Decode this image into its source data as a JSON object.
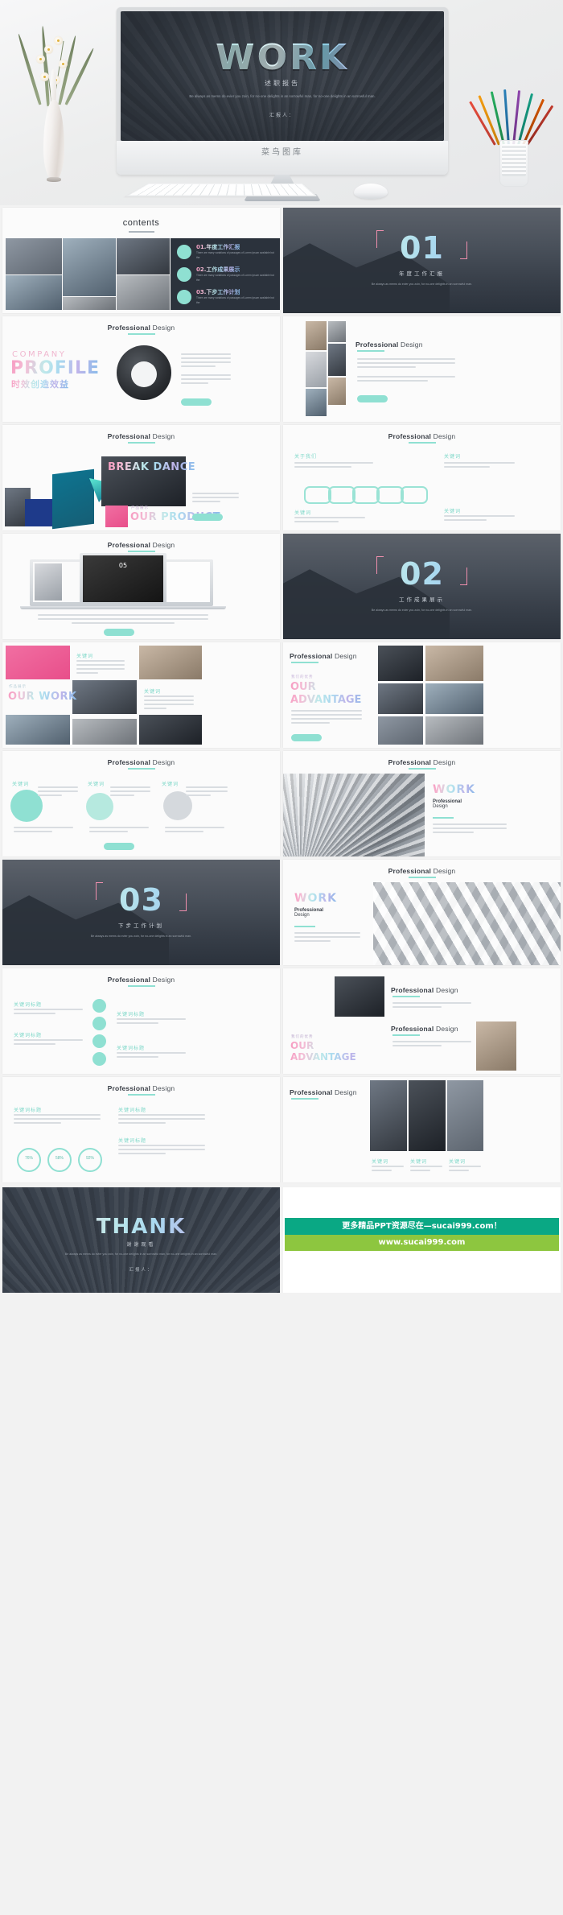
{
  "hero": {
    "brand": "菜鸟图库",
    "screen": {
      "title": "WORK",
      "subtitle": "述职报告",
      "paragraph": "Be always as mems do evier you zoin, for no-one delights in an sorrowful man, for no-one delights in an sorrowful man.",
      "presenter": "汇报人："
    }
  },
  "slides": [
    {
      "id": "contents",
      "kind": "contents",
      "title": "contents",
      "items": [
        {
          "num": "01.",
          "cn": "年度工作汇报",
          "desc": "There are many variations of passages of Lorem Ipsum available but the"
        },
        {
          "num": "02.",
          "cn": "工作成果展示",
          "desc": "There are many variations of passages of Lorem Ipsum available but the"
        },
        {
          "num": "03.",
          "cn": "下步工作计划",
          "desc": "There are many variations of passages of Lorem Ipsum available but the"
        }
      ]
    },
    {
      "id": "section-01",
      "kind": "section",
      "number": "01",
      "cn": "年度工作汇报",
      "en": "Be always as mems do evier you zoin, for no-one delights in an sorrowful man."
    },
    {
      "id": "company-profile",
      "kind": "profile",
      "header": {
        "bold": "Professional",
        "light": "Design"
      },
      "overline": "COMPANY",
      "bigword": "PROFILE",
      "cn": "时效创造效益",
      "body": "本本我是一个全面规划世界，我们与合作伙伴一起，开放合作，努力构建一个连接高速度的数字生态圈，让进人与人、人与物、物与物智能互连充满可实现，使美每个人应用权利化。",
      "button": "More"
    },
    {
      "id": "team-gallery",
      "kind": "gallery-right",
      "header": {
        "bold": "Professional",
        "light": "Design"
      },
      "body1": "本本我是一个全面规划世界，我们与合作伙伴一起，开放合作，努力构建一个连接高速度的数字生态圈，让进人与人、人与物、物与物智能互连充满可实现。",
      "body2": "努力构建一个连接高速度的数字生态圈，让进人与人、人与物、物与物智能互连充满可实现，使美每个人应用权利化。",
      "button": "More"
    },
    {
      "id": "our-product",
      "kind": "product",
      "header": {
        "bold": "Professional",
        "light": "Design"
      },
      "overline": "产品展示",
      "bigword": "OUR PRODUCT",
      "body": "本本我是一个全面规划世界，我们与合作伙伴一起，开放合作，努力构建一个连接高速度的数字生态圈。",
      "button": "More",
      "card_title": "BREAK DANCE"
    },
    {
      "id": "chain-process",
      "kind": "chain",
      "header": {
        "bold": "Professional",
        "light": "Design"
      },
      "cn": "关于我们",
      "body": "我们是每位客户的中心，快速响应客户需求，为客户提供优质可靠服务的贴心好客户",
      "labels": [
        "关键词",
        "关键词",
        "关键词",
        "关键词"
      ]
    },
    {
      "id": "device-showcase",
      "kind": "devices",
      "header": {
        "bold": "Professional",
        "light": "Design"
      },
      "screen_num": "05",
      "body": "本本我是一个全面规划世界，我们与合作伙伴一起，开放合作，努力构建一个连接高速度的数字生态圈，让进人与人、人与物、物与物智能互连充满可实现，使美每个人应用权利化。本本我是一个全面规划世界，我们与合作伙伴一起，开放合作。",
      "button": "More"
    },
    {
      "id": "section-02",
      "kind": "section",
      "number": "02",
      "cn": "工作成果展示",
      "en": "Be always as mems do evier you zoin, for no-one delights in an sorrowful man."
    },
    {
      "id": "our-work",
      "kind": "mosaic",
      "overline": "作品展示",
      "bigword": "OUR WORK",
      "tiles": [
        {
          "cn": "关键词",
          "body": "我们是每位客户的中心，快速响应客户需求，为客户提供优质可靠服务的贴心好客户，让你工作更轻松。"
        },
        {
          "cn": "关键词",
          "body": "我们是每位客户的中心，快速响应客户需求，为客户提供优质可靠服务的贴心好客户，让你工作更轻松。"
        }
      ]
    },
    {
      "id": "our-advantage",
      "kind": "advantage",
      "header": {
        "bold": "Professional",
        "light": "Design"
      },
      "overline": "我们的优势",
      "bigword": "OUR ADVANTAGE",
      "body": "本本我是一个全面规划世界，我们与合作伙伴一起，开放合作，努力构建一个连接高速度的数字生态圈，让进人与人、人与物、物与物智能互连充满可实现。"
    },
    {
      "id": "circle-stats",
      "kind": "circles",
      "header": {
        "bold": "Professional",
        "light": "Design"
      },
      "columns": [
        {
          "cn": "关键词",
          "body": "我们是每位客户的中心，快速响应客户需求，为客户提供优质可靠服务的贴心好客户。"
        },
        {
          "cn": "关键词",
          "body": "我们是每位客户的中心，快速响应客户需求，为客户提供优质可靠服务的贴心好客户。"
        },
        {
          "cn": "关键词",
          "body": "我们是每位客户的中心，快速响应客户需求，为客户提供优质可靠服务的贴心好客户。"
        }
      ],
      "button": "More"
    },
    {
      "id": "work-texture",
      "kind": "texture-right",
      "header": {
        "bold": "Professional",
        "light": "Design"
      },
      "bigword": "WORK",
      "sub": {
        "bold": "Professional",
        "light": "Design"
      },
      "body": "我们是每位客户的中心，快速响应客户需求，为客户提供优质可靠服务的贴心好客户，让你工作更轻松。"
    },
    {
      "id": "section-03",
      "kind": "section",
      "number": "03",
      "cn": "下步工作计划",
      "en": "Be always as mems do evier you zoin, for no-one delights in an sorrowful man."
    },
    {
      "id": "work-cubes",
      "kind": "cubes",
      "header": {
        "bold": "Professional",
        "light": "Design"
      },
      "bigword": "WORK",
      "sub": {
        "bold": "Professional",
        "light": "Design"
      },
      "body": "我们是每位客户的中心，快速响应客户需求，为客户提供优质可靠服务的贴心好客户。"
    },
    {
      "id": "timeline-list",
      "kind": "timeline",
      "header": {
        "bold": "Professional",
        "light": "Design"
      },
      "rows": [
        {
          "cn": "关键词标题",
          "body": "我们是每位客户的中心，快速响应客户需求，为客户提供优质可靠服务。"
        },
        {
          "cn": "关键词标题",
          "body": "我们是每位客户的中心，快速响应客户需求，为客户提供优质可靠服务。"
        },
        {
          "cn": "关键词标题",
          "body": "我们是每位客户的中心，快速响应客户需求，为客户提供优质可靠服务。"
        },
        {
          "cn": "关键词标题",
          "body": "我们是每位客户的中心，快速响应客户需求，为客户提供优质可靠服务。"
        }
      ]
    },
    {
      "id": "advantage-split",
      "kind": "split",
      "header_top": {
        "bold": "Professional",
        "light": "Design"
      },
      "header_bottom": {
        "bold": "Professional",
        "light": "Design"
      },
      "overline": "我们的优势",
      "bigword": "OUR ADVANTAGE",
      "body_top": "我们是每位客户的中心，快速响应客户需求，为客户提供优质可靠服务的贴心好客户。",
      "body_bottom": "我们是每位客户的中心，快速响应客户需求，为客户提供优质可靠服务的贴心好客户。"
    },
    {
      "id": "stats-circles",
      "kind": "stats",
      "header": {
        "bold": "Professional",
        "light": "Design"
      },
      "blocks": [
        {
          "cn": "关键词标题",
          "body": "我们是每位客户的中心，快速响应客户需求，为客户提供优质可靠服务的贴心好客户。"
        },
        {
          "cn": "关键词标题",
          "body": "我们是每位客户的中心，快速响应客户需求，为客户提供优质可靠服务的贴心好客户。"
        },
        {
          "cn": "关键词标题",
          "body": "我们是每位客户的中心，快速响应客户需求，为客户提供优质可靠服务的贴心好客户。"
        }
      ],
      "ring_values": [
        "76%",
        "58%",
        "92%"
      ]
    },
    {
      "id": "portrait-grid",
      "kind": "portraits",
      "header": {
        "bold": "Professional",
        "light": "Design"
      },
      "captions": [
        {
          "cn": "关键词",
          "body": "我们是每位客户的中心，快速响应客户需求。"
        },
        {
          "cn": "关键词",
          "body": "我们是每位客户的中心，快速响应客户需求。"
        },
        {
          "cn": "关键词",
          "body": "我们是每位客户的中心，快速响应客户需求。"
        }
      ]
    }
  ],
  "thanks": {
    "title": "THANK",
    "subtitle": "谢谢观看",
    "paragraph": "Be always as mems do evier you zoin, for no-one delights in an sorrowful man, for no-one delights in an sorrowful man.",
    "presenter": "汇报人："
  },
  "promo": {
    "line1": "更多精品PPT资源尽在—sucai999.com！",
    "line2": "www.sucai999.com",
    "color1": "#0aa884",
    "color2": "#8dc63f"
  }
}
